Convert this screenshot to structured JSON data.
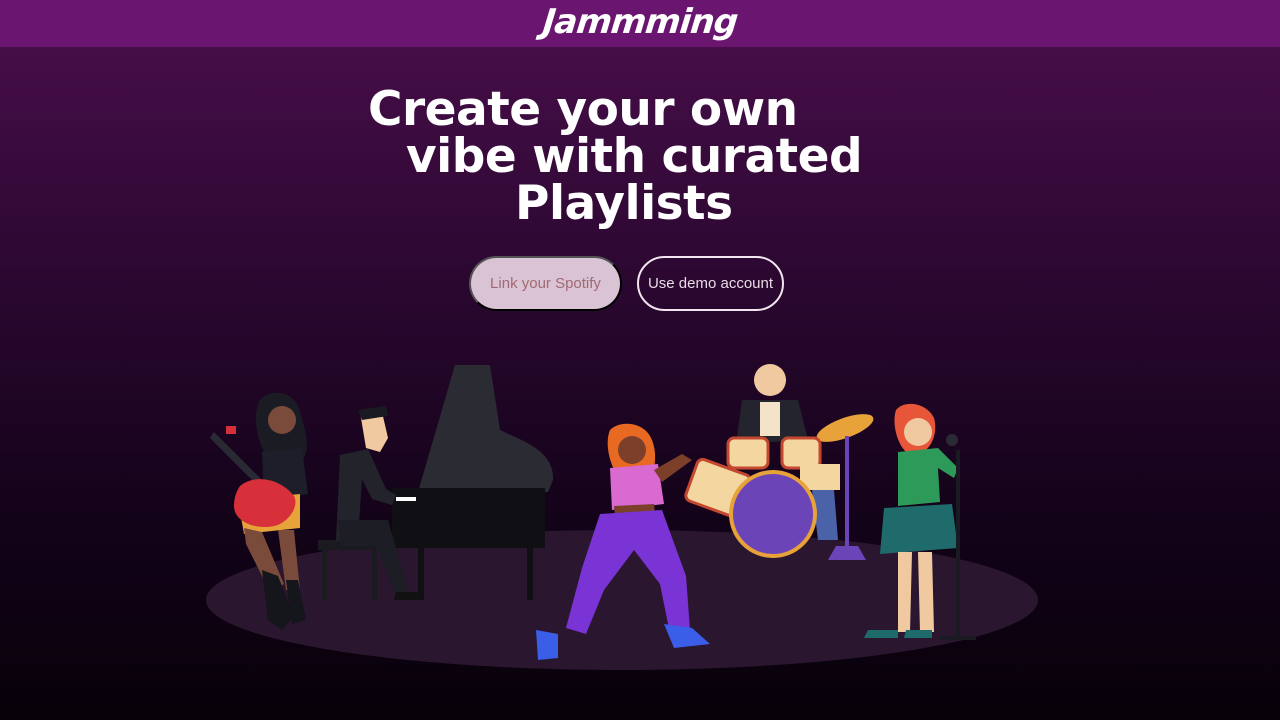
{
  "header": {
    "logo_text": "Jammming"
  },
  "hero": {
    "line1": "Create your own",
    "line2": "vibe with curated",
    "line3": "Playlists"
  },
  "actions": {
    "link_spotify_label": "Link your Spotify",
    "demo_label": "Use demo account"
  },
  "colors": {
    "topbar": "#6a1670",
    "primary_button_bg": "#d9c3d4",
    "primary_button_text": "#a16a72",
    "stage_floor": "#2b1630"
  },
  "illustration": {
    "subject": "band-on-stage",
    "performers": [
      "guitarist",
      "pianist",
      "dancer",
      "drummer",
      "singer"
    ]
  }
}
